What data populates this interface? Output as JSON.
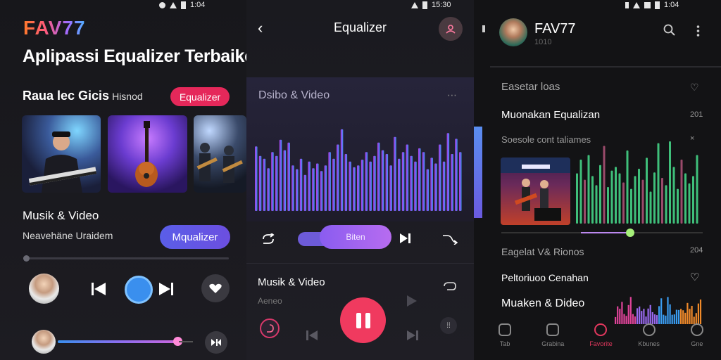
{
  "left_panel": {
    "status_time": "1:04",
    "logo": "FAV77",
    "headline": "Aplipassi Equalizer Terbaikepackur & Video",
    "section_title": "Raua lec Gicis",
    "section_title_small": "Hisnod",
    "eq_pill": "Equalizer",
    "media_label": "Musik & Video",
    "media_sub": "Neavehäne Uraidem",
    "action_button": "Mqualizer"
  },
  "center_panel": {
    "status_time": "15:30",
    "title": "Equalizer",
    "eq_label": "Dsibo & Video",
    "eq_menu": "⋯",
    "slider_label": "Biten",
    "track_label": "Musik & Video",
    "track_sub": "Aeneo",
    "eq_levels": [
      0.68,
      0.58,
      0.55,
      0.45,
      0.62,
      0.58,
      0.75,
      0.64,
      0.72,
      0.48,
      0.44,
      0.55,
      0.38,
      0.52,
      0.45,
      0.5,
      0.42,
      0.48,
      0.62,
      0.55,
      0.7,
      0.86,
      0.6,
      0.52,
      0.46,
      0.48,
      0.54,
      0.62,
      0.52,
      0.58,
      0.72,
      0.64,
      0.6,
      0.48,
      0.78,
      0.55,
      0.62,
      0.7,
      0.58,
      0.52,
      0.66,
      0.62,
      0.44,
      0.56,
      0.5,
      0.7,
      0.52,
      0.82,
      0.6,
      0.76,
      0.62
    ]
  },
  "right_panel": {
    "status_time": "1:04",
    "app_name": "FAV77",
    "app_sub": "1010",
    "rows": [
      {
        "label": "Easetar loas",
        "meta": "♡"
      },
      {
        "label": "Muonakan Equalizan",
        "meta": "201"
      },
      {
        "label": "Soesole cont taliames",
        "meta": "×"
      },
      {
        "label": "Eagelat V& Rionos",
        "meta": "204"
      },
      {
        "label": "Peltoriuoo Cenahan",
        "meta": "♡"
      },
      {
        "label": "Muaken & Dideo",
        "meta": ""
      }
    ],
    "green_eq": [
      0.55,
      0.7,
      0.48,
      0.75,
      0.52,
      0.42,
      0.64,
      0.85,
      0.4,
      0.58,
      0.62,
      0.55,
      0.45,
      0.8,
      0.38,
      0.52,
      0.6,
      0.48,
      0.72,
      0.35,
      0.56,
      0.88,
      0.5,
      0.42,
      0.9,
      0.62,
      0.38,
      0.7,
      0.55,
      0.44,
      0.52,
      0.75
    ],
    "tabs": [
      "Tab",
      "Grabina",
      "Favorite",
      "Kbunes",
      "Gne"
    ]
  },
  "colors": {
    "accent_pink": "#e5285a",
    "accent_blue": "#3a8fee",
    "accent_purple": "#6c4fe0",
    "eq_green": "#3fbf7a"
  }
}
